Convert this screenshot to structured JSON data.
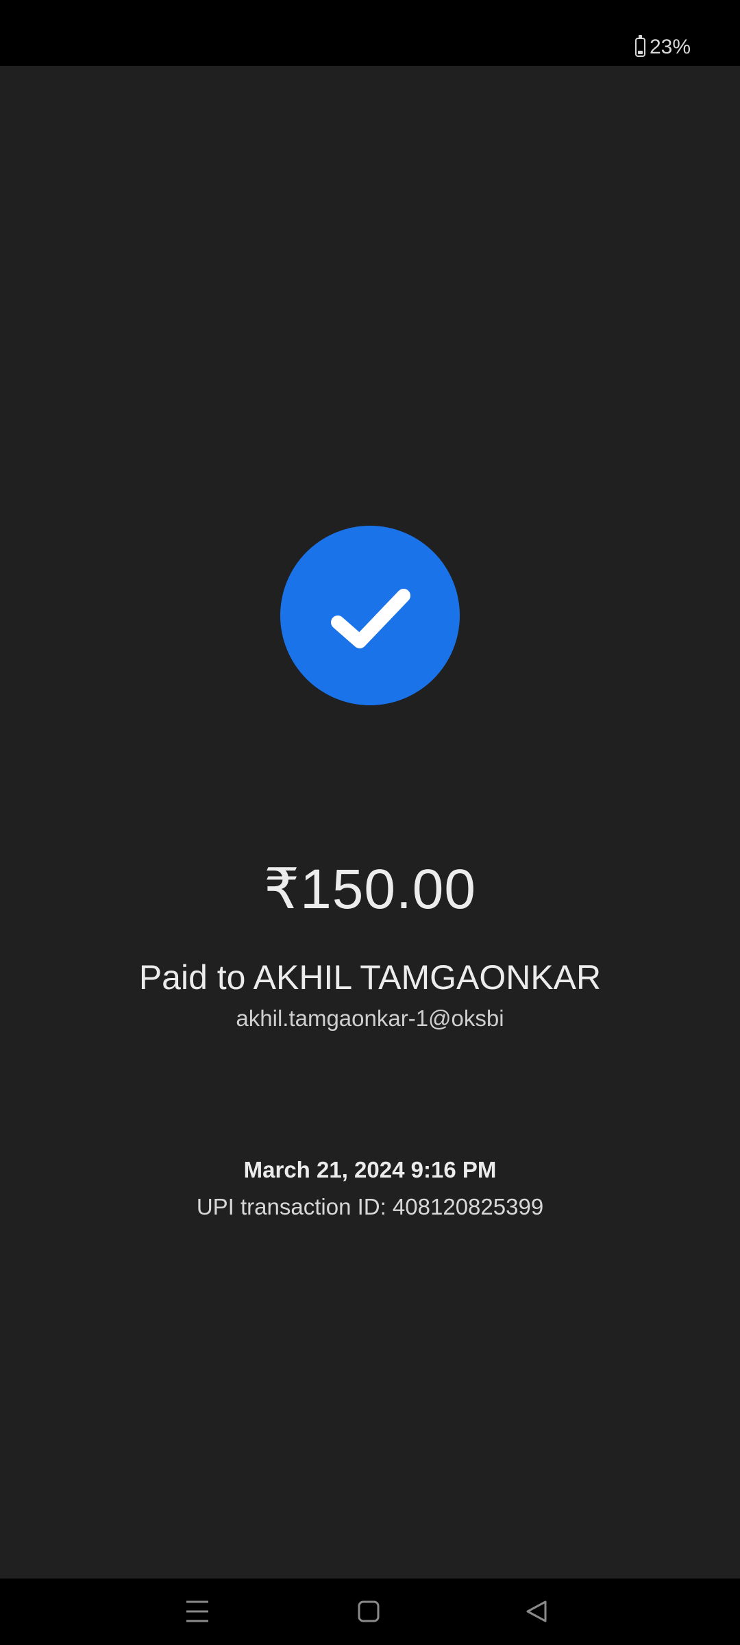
{
  "status_bar": {
    "battery_level": "23%",
    "battery_icon": "battery-icon"
  },
  "payment": {
    "status_icon": "check-circle-icon",
    "accent_color": "#1a73e8",
    "amount": "₹150.00",
    "paid_to": "Paid to AKHIL TAMGAONKAR",
    "upi_id": "akhil.tamgaonkar-1@oksbi",
    "datetime": "March 21, 2024 9:16 PM",
    "transaction_id": "UPI transaction ID: 408120825399"
  },
  "nav_bar": {
    "buttons": [
      "menu-icon",
      "home-icon",
      "back-icon"
    ]
  }
}
